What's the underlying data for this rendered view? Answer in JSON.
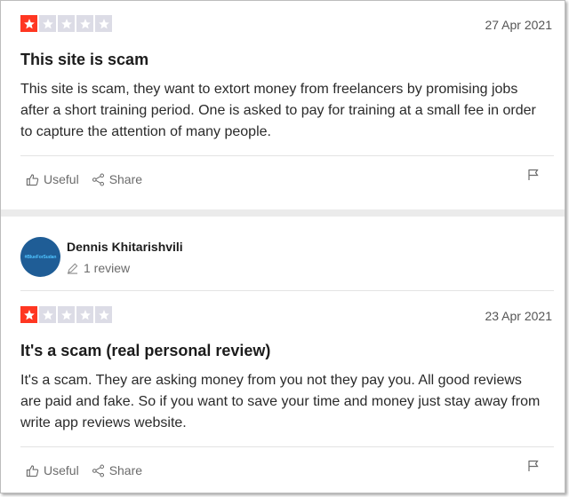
{
  "colors": {
    "accent": "#ff3722",
    "empty_star": "#dcdce6"
  },
  "reviews": [
    {
      "rating": 1,
      "rating_max": 5,
      "date": "27 Apr 2021",
      "title": "This site is scam",
      "body": "This site is scam, they want to extort money from freelancers by promising jobs after a short training period. One is asked to pay for training at a small fee in order to capture the attention of many people.",
      "useful_label": "Useful",
      "share_label": "Share"
    },
    {
      "author": {
        "name": "Dennis Khitarishvili",
        "avatar_text": "#BlueForSudan",
        "review_count": "1 review"
      },
      "rating": 1,
      "rating_max": 5,
      "date": "23 Apr 2021",
      "title": "It's a scam (real personal review)",
      "body": "It's a scam. They are asking money from you not they pay you. All good reviews are paid and fake. So if you want to save your time and money just stay away from write app reviews website.",
      "useful_label": "Useful",
      "share_label": "Share"
    }
  ]
}
